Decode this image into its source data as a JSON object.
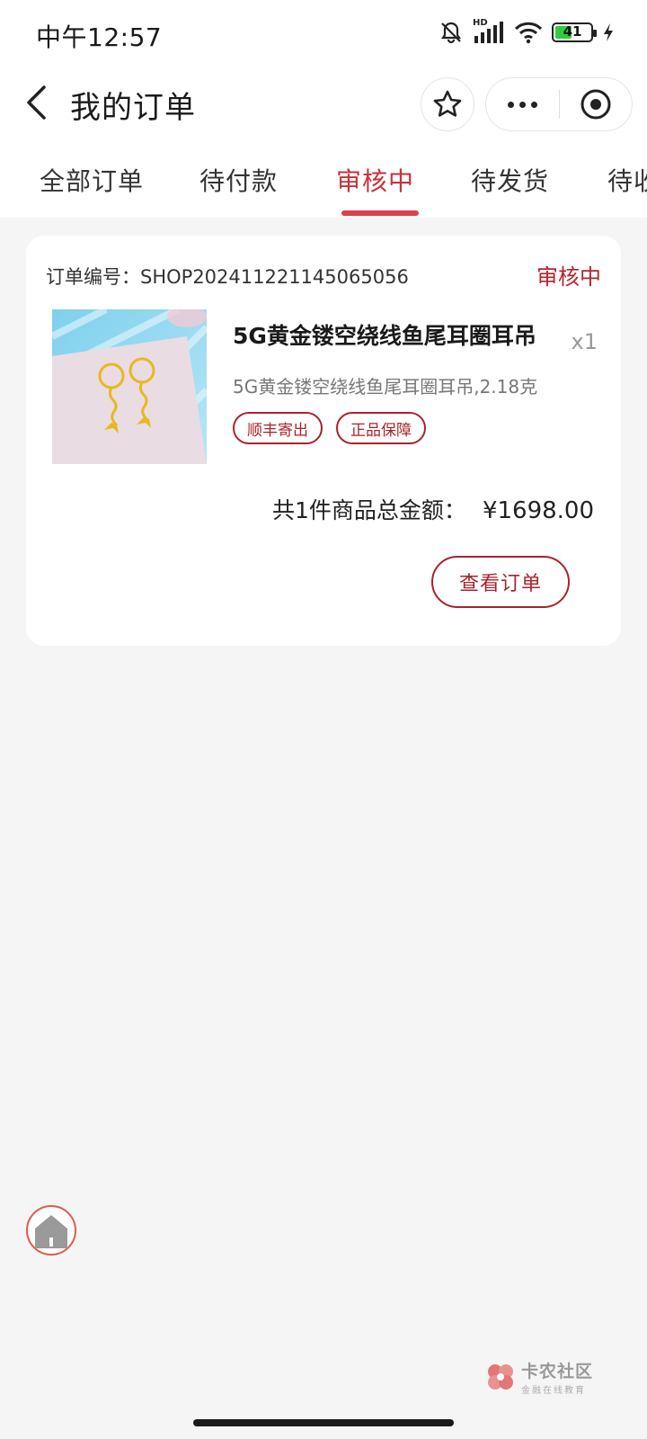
{
  "status_bar": {
    "time": "中午12:57",
    "battery_level": "41",
    "network_badge": "HD"
  },
  "nav": {
    "title": "我的订单"
  },
  "tabs": [
    {
      "label": "全部订单",
      "active": false
    },
    {
      "label": "待付款",
      "active": false
    },
    {
      "label": "审核中",
      "active": true
    },
    {
      "label": "待发货",
      "active": false
    },
    {
      "label": "待收货",
      "active": false
    }
  ],
  "order": {
    "number_label": "订单编号：",
    "number": "SHOP20241122114506505​6",
    "status": "审核中",
    "product": {
      "title": "5G黄金镂空绕线鱼尾耳圈耳吊",
      "quantity": "x1",
      "spec": "5G黄金镂空绕线鱼尾耳圈耳吊,2.18克",
      "tags": [
        "顺丰寄出",
        "正品保障"
      ]
    },
    "total_label": "共1件商品总金额：",
    "total_amount": "¥1698.00",
    "view_button": "查看订单"
  },
  "watermark": {
    "title": "卡农社区",
    "subtitle": "金融在线教育"
  },
  "colors": {
    "accent": "#c8313b",
    "tag_border": "#a8232b",
    "background": "#f5f5f5"
  }
}
